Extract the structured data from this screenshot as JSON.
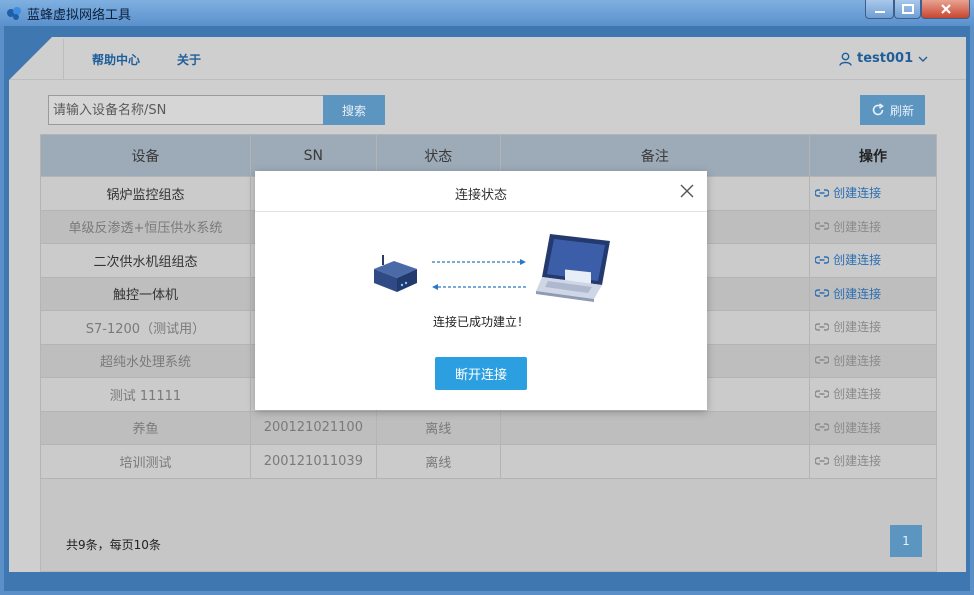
{
  "window": {
    "title": "蓝蜂虚拟网络工具"
  },
  "nav": {
    "help": "帮助中心",
    "about": "关于",
    "username": "test001"
  },
  "search": {
    "placeholder": "请输入设备名称/SN",
    "button": "搜索"
  },
  "refresh": {
    "label": "刷新"
  },
  "table": {
    "headers": {
      "device": "设备",
      "sn": "SN",
      "status": "状态",
      "note": "备注",
      "op": "操作"
    },
    "rows": [
      {
        "device": "锅炉监控组态",
        "sn": "",
        "status": "",
        "note": "",
        "op": "创建连接",
        "active": true
      },
      {
        "device": "单级反渗透+恒压供水系统",
        "sn": "",
        "status": "",
        "note": "",
        "op": "创建连接",
        "active": false
      },
      {
        "device": "二次供水机组组态",
        "sn": "",
        "status": "",
        "note": "",
        "op": "创建连接",
        "active": true
      },
      {
        "device": "触控一体机",
        "sn": "",
        "status": "",
        "note": "",
        "op": "创建连接",
        "active": true
      },
      {
        "device": "S7-1200（测试用）",
        "sn": "",
        "status": "",
        "note": "",
        "op": "创建连接",
        "active": false
      },
      {
        "device": "超纯水处理系统",
        "sn": "",
        "status": "",
        "note": "",
        "op": "创建连接",
        "active": false
      },
      {
        "device": "测试 11111",
        "sn": "",
        "status": "",
        "note": "",
        "op": "创建连接",
        "active": false
      },
      {
        "device": "养鱼",
        "sn": "200121021100",
        "status": "离线",
        "note": "",
        "op": "创建连接",
        "active": false
      },
      {
        "device": "培训测试",
        "sn": "200121011039",
        "status": "离线",
        "note": "",
        "op": "创建连接",
        "active": false
      }
    ]
  },
  "pagination": {
    "summary": "共9条，每页10条",
    "current_page": "1"
  },
  "modal": {
    "title": "连接状态",
    "message": "连接已成功建立！",
    "button": "断开连接"
  },
  "icons": {
    "app": "bee-logo-icon",
    "user": "user-icon",
    "dropdown": "chevron-down-icon",
    "refresh": "refresh-icon",
    "link": "link-icon",
    "close": "close-icon",
    "device": "router-icon",
    "computer": "laptop-icon"
  },
  "colors": {
    "accent": "#2b9fe0",
    "link": "#2b6fb3",
    "window_frame": "#3f77b0"
  }
}
